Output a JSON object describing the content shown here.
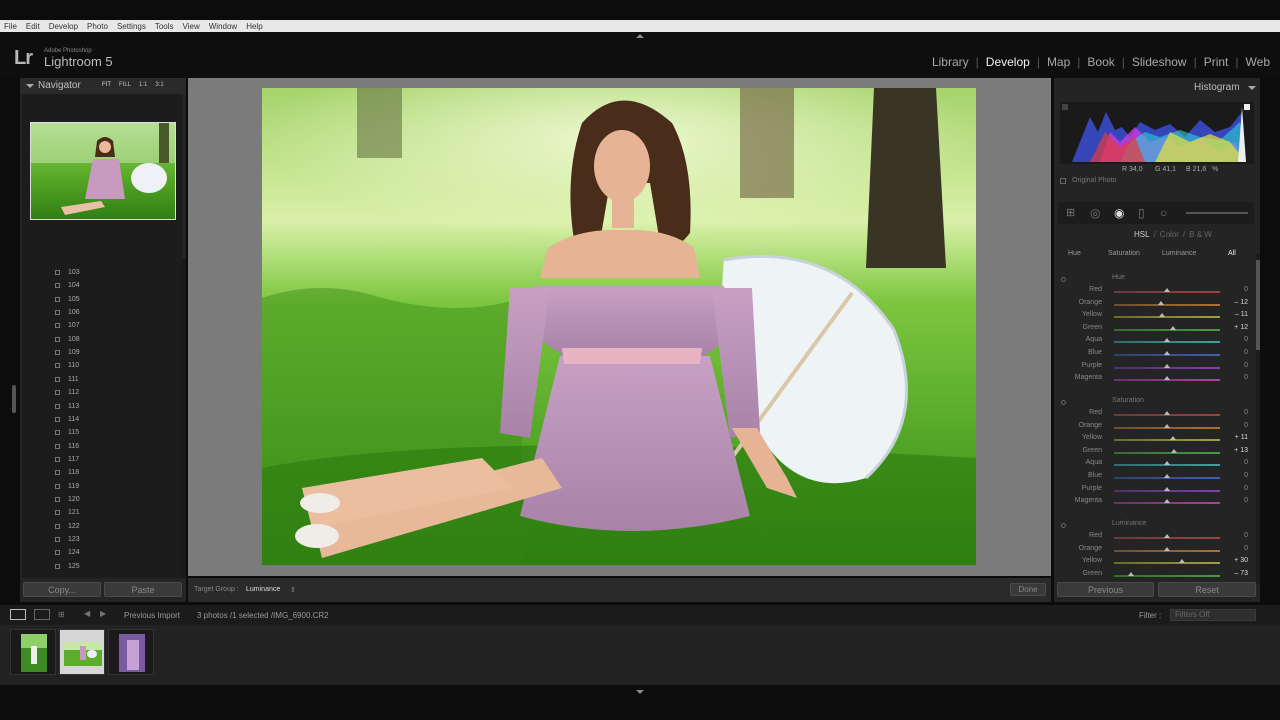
{
  "menu": [
    "File",
    "Edit",
    "Develop",
    "Photo",
    "Settings",
    "Tools",
    "View",
    "Window",
    "Help"
  ],
  "app": {
    "logo": "Lr",
    "vendor": "Adobe Photoshop",
    "name": "Lightroom 5"
  },
  "modules": [
    "Library",
    "Develop",
    "Map",
    "Book",
    "Slideshow",
    "Print",
    "Web"
  ],
  "module_active": "Develop",
  "navigator": {
    "title": "Navigator",
    "zoom": [
      "FIT",
      "FILL",
      "1:1",
      "3:1"
    ]
  },
  "history": [
    "103",
    "104",
    "105",
    "106",
    "107",
    "108",
    "109",
    "110",
    "111",
    "112",
    "113",
    "114",
    "115",
    "116",
    "117",
    "118",
    "119",
    "120",
    "121",
    "122",
    "123",
    "124",
    "125"
  ],
  "left_buttons": {
    "copy": "Copy...",
    "paste": "Paste"
  },
  "toolbar": {
    "target_label": "Target Group :",
    "target_value": "Luminance",
    "done": "Done"
  },
  "histogram": {
    "title": "Histogram",
    "r": "R 34,0",
    "g": "G 41,1",
    "b": "B 21,6",
    "pct": "%",
    "original": "Original Photo"
  },
  "hsl": {
    "tabs": [
      "HSL",
      "/",
      "Color",
      "/",
      "B & W"
    ],
    "subtabs": [
      "Hue",
      "Saturation",
      "Luminance",
      "All"
    ],
    "groups": [
      {
        "title": "Hue",
        "rows": [
          {
            "label": "Red",
            "value": "0"
          },
          {
            "label": "Orange",
            "value": "– 12"
          },
          {
            "label": "Yellow",
            "value": "– 11"
          },
          {
            "label": "Green",
            "value": "+ 12"
          },
          {
            "label": "Aqua",
            "value": "0"
          },
          {
            "label": "Blue",
            "value": "0"
          },
          {
            "label": "Purple",
            "value": "0"
          },
          {
            "label": "Magenta",
            "value": "0"
          }
        ]
      },
      {
        "title": "Saturation",
        "rows": [
          {
            "label": "Red",
            "value": "0"
          },
          {
            "label": "Orange",
            "value": "0"
          },
          {
            "label": "Yellow",
            "value": "+ 11"
          },
          {
            "label": "Green",
            "value": "+ 13"
          },
          {
            "label": "Aqua",
            "value": "0"
          },
          {
            "label": "Blue",
            "value": "0"
          },
          {
            "label": "Purple",
            "value": "0"
          },
          {
            "label": "Magenta",
            "value": "0"
          }
        ]
      },
      {
        "title": "Luminance",
        "rows": [
          {
            "label": "Red",
            "value": "0"
          },
          {
            "label": "Orange",
            "value": "0"
          },
          {
            "label": "Yellow",
            "value": "+ 30"
          },
          {
            "label": "Green",
            "value": "– 73"
          }
        ]
      }
    ]
  },
  "right_buttons": {
    "previous": "Previous",
    "reset": "Reset"
  },
  "filmstrip": {
    "source": "Previous Import",
    "info": "3 photos /1 selected /IMG_6900.CR2",
    "filter_label": "Filter :",
    "filter_value": "Filters Off"
  },
  "colors": {
    "accent": "#f2f2f2",
    "panel": "#242424",
    "center_bg": "#7b7b7b"
  }
}
